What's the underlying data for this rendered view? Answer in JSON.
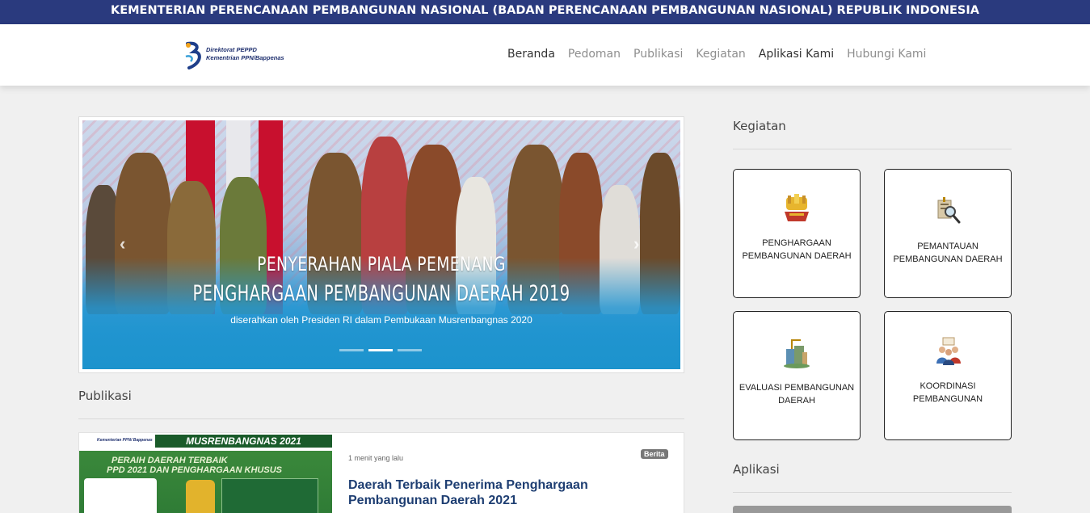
{
  "topbar": {
    "text": "KEMENTERIAN PERENCANAAN PEMBANGUNAN NASIONAL (BADAN PERENCANAAN PEMBANGUNAN NASIONAL) REPUBLIK INDONESIA"
  },
  "logo": {
    "line1": "Direktorat PEPPD",
    "line2": "Kementrian PPN/Bappenas"
  },
  "nav": {
    "items": [
      {
        "label": "Beranda"
      },
      {
        "label": "Pedoman"
      },
      {
        "label": "Publikasi"
      },
      {
        "label": "Kegiatan"
      },
      {
        "label": "Aplikasi Kami"
      },
      {
        "label": "Hubungi Kami"
      }
    ]
  },
  "carousel": {
    "caption_line1": "PENYERAHAN PIALA PEMENANG",
    "caption_line2": "PENGHARGAAN PEMBANGUNAN DAERAH 2019",
    "caption_sub": "diserahkan oleh Presiden RI dalam Pembukaan Musrenbangnas 2020",
    "prev_icon": "chevron-left-icon",
    "next_icon": "chevron-right-icon",
    "active_indicator": 2,
    "indicator_count": 3
  },
  "publikasi": {
    "heading": "Publikasi",
    "card": {
      "thumb_header": "MUSRENBANGNAS 2021",
      "thumb_brand": "Kementerian PPN/ Bappenas",
      "thumb_line1": "PERAIH DAERAH TERBAIK",
      "thumb_line2": "PPD 2021 DAN PENGHARGAAN KHUSUS",
      "time": "1 menit yang lalu",
      "badge": "Berita",
      "title": "Daerah Terbaik Penerima Penghargaan Pembangunan Daerah 2021"
    }
  },
  "kegiatan": {
    "heading": "Kegiatan",
    "cards": [
      {
        "label": "PENGHARGAAN PEMBANGUNAN DAERAH",
        "icon": "award-trophy-icon"
      },
      {
        "label": "PEMANTAUAN PEMBANGUNAN DAERAH",
        "icon": "magnifier-document-icon"
      },
      {
        "label": "EVALUASI PEMBANGUNAN DAERAH",
        "icon": "city-building-icon"
      },
      {
        "label": "KOORDINASI PEMBANGUNAN",
        "icon": "people-meeting-icon"
      }
    ]
  },
  "aplikasi": {
    "heading": "Aplikasi"
  },
  "colors": {
    "topbar": "#2a3a7e",
    "title_link": "#1e3e72",
    "nav_active": "#333333",
    "nav_inactive": "#8e8e8e"
  }
}
